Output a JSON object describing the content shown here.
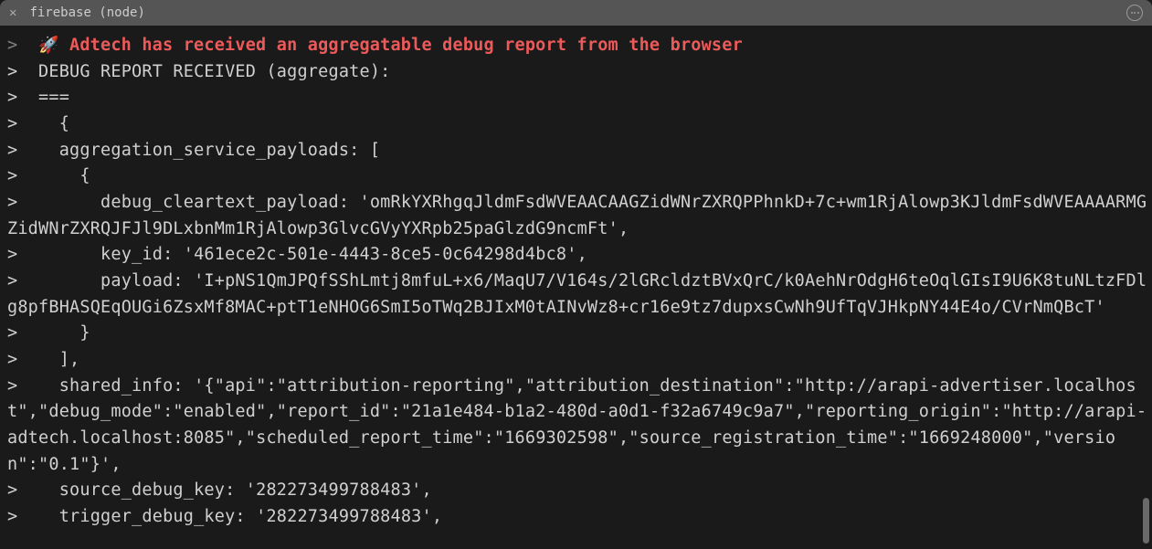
{
  "titlebar": {
    "title": "firebase (node)"
  },
  "terminal": {
    "prompt": ">  ",
    "rocket": "🚀",
    "headline": " Adtech has received an aggregatable debug report from the browser",
    "lines": [
      ">  DEBUG REPORT RECEIVED (aggregate):",
      ">  ===",
      ">    {",
      ">    aggregation_service_payloads: [",
      ">      {",
      ">        debug_cleartext_payload: 'omRkYXRhgqJldmFsdWVEAACAAGZidWNrZXRQPPhnkD+7c+wm1RjAlowp3KJldmFsdWVEAAAARMGZidWNrZXRQJFJl9DLxbnMm1RjAlowp3GlvcGVyYXRpb25paGlzdG9ncmFt',",
      ">        key_id: '461ece2c-501e-4443-8ce5-0c64298d4bc8',",
      ">        payload: 'I+pNS1QmJPQfSShLmtj8mfuL+x6/MaqU7/V164s/2lGRcldztBVxQrC/k0AehNrOdgH6teOqlGIsI9U6K8tuNLtzFDlg8pfBHASQEqOUGi6ZsxMf8MAC+ptT1eNHOG6SmI5oTWq2BJIxM0tAINvWz8+cr16e9tz7dupxsCwNh9UfTqVJHkpNY44E4o/CVrNmQBcT'",
      ">      }",
      ">    ],",
      ">    shared_info: '{\"api\":\"attribution-reporting\",\"attribution_destination\":\"http://arapi-advertiser.localhost\",\"debug_mode\":\"enabled\",\"report_id\":\"21a1e484-b1a2-480d-a0d1-f32a6749c9a7\",\"reporting_origin\":\"http://arapi-adtech.localhost:8085\",\"scheduled_report_time\":\"1669302598\",\"source_registration_time\":\"1669248000\",\"version\":\"0.1\"}',",
      ">    source_debug_key: '282273499788483',",
      ">    trigger_debug_key: '282273499788483',"
    ]
  }
}
